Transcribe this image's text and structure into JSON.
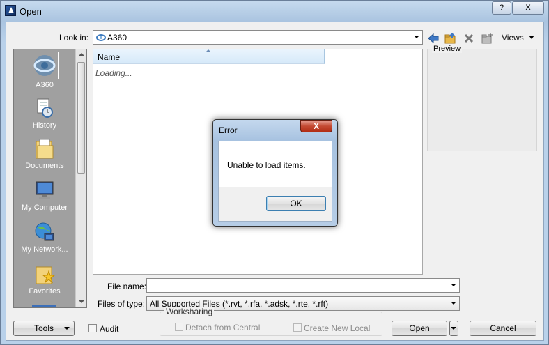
{
  "window": {
    "title": "Open",
    "help_label": "?",
    "close_label": "X"
  },
  "toolbar": {
    "look_in_label": "Look in:",
    "look_in_value": "A360",
    "views_label": "Views",
    "icons": [
      "back-arrow-icon",
      "up-folder-icon",
      "delete-icon",
      "new-folder-icon"
    ]
  },
  "places": [
    {
      "label": "A360",
      "icon": "a360-icon",
      "selected": true
    },
    {
      "label": "History",
      "icon": "history-icon"
    },
    {
      "label": "Documents",
      "icon": "documents-folder-icon"
    },
    {
      "label": "My Computer",
      "icon": "my-computer-icon"
    },
    {
      "label": "My Network...",
      "icon": "my-network-icon"
    },
    {
      "label": "Favorites",
      "icon": "favorites-folder-icon"
    }
  ],
  "filelist": {
    "column_name": "Name",
    "loading_text": "Loading..."
  },
  "preview": {
    "title": "Preview"
  },
  "form": {
    "file_name_label": "File name:",
    "file_name_value": "",
    "files_of_type_label": "Files of type:",
    "files_of_type_value": "All Supported Files  (*.rvt, *.rfa, *.adsk, *.rte, *.rft)"
  },
  "bottom": {
    "tools_label": "Tools",
    "audit_label": "Audit",
    "worksharing_title": "Worksharing",
    "detach_label": "Detach from Central",
    "create_local_label": "Create New Local",
    "open_label": "Open",
    "cancel_label": "Cancel"
  },
  "error_dialog": {
    "title": "Error",
    "close_label": "X",
    "message": "Unable to load items.",
    "ok_label": "OK"
  }
}
